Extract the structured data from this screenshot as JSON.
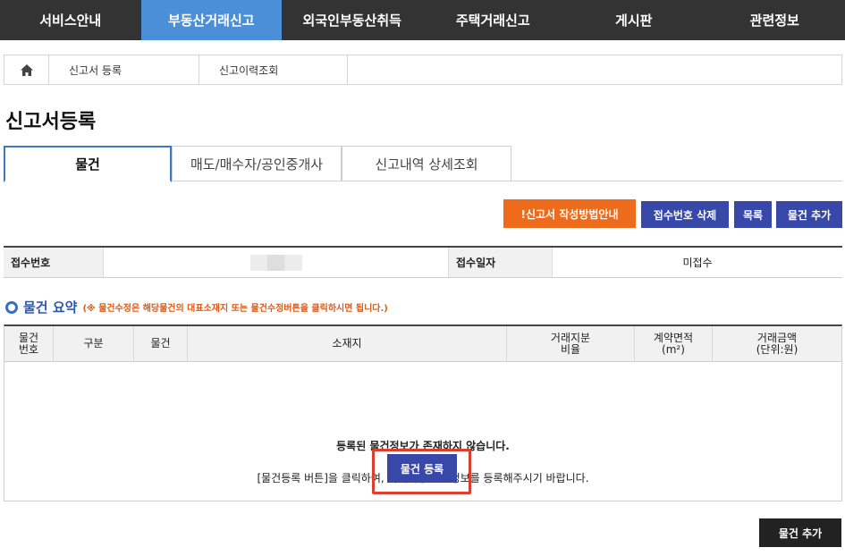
{
  "nav": {
    "items": [
      {
        "label": "서비스안내"
      },
      {
        "label": "부동산거래신고"
      },
      {
        "label": "외국인부동산취득"
      },
      {
        "label": "주택거래신고"
      },
      {
        "label": "게시판"
      },
      {
        "label": "관련정보"
      }
    ],
    "active_index": 1,
    "active_color": "#4a8fd8"
  },
  "breadcrumb": {
    "home_icon": "home-icon",
    "items": [
      "신고서 등록",
      "신고이력조회"
    ]
  },
  "page_title": "신고서등록",
  "tabs": [
    {
      "label": "물건"
    },
    {
      "label": "매도/매수자/공인중개사"
    },
    {
      "label": "신고내역 상세조회"
    }
  ],
  "actions": {
    "guide_label": "!신고서 작성방법안내",
    "delete_label": "접수번호 삭제",
    "list_label": "목록",
    "add_label": "물건 추가"
  },
  "receipt": {
    "number_label": "접수번호",
    "number_value": "",
    "date_label": "접수일자",
    "date_value": "미접수"
  },
  "summary": {
    "title": "물건 요약",
    "note": "(※ 물건수정은 해당물건의 대표소재지 또는 물건수정버튼을 클릭하시면 됩니다.)"
  },
  "table": {
    "headers": [
      "물건\n번호",
      "구분",
      "물건",
      "소재지",
      "거래지분\n비율",
      "계약면적\n(m²)",
      "거래금액\n(단위:원)"
    ],
    "empty_title": "등록된 물건정보가 존재하지 않습니다.",
    "empty_desc": "[물건등록 버튼]을 클릭하여, 거래대상 물건정보를 등록해주시기 바랍니다.",
    "register_label": "물건 등록"
  },
  "bottom": {
    "add_label": "물건 추가"
  },
  "colors": {
    "primary_button": "#3848a8",
    "guide_button": "#ee6b1c",
    "highlight_border": "#d8412b",
    "nav_bg": "#333333"
  }
}
